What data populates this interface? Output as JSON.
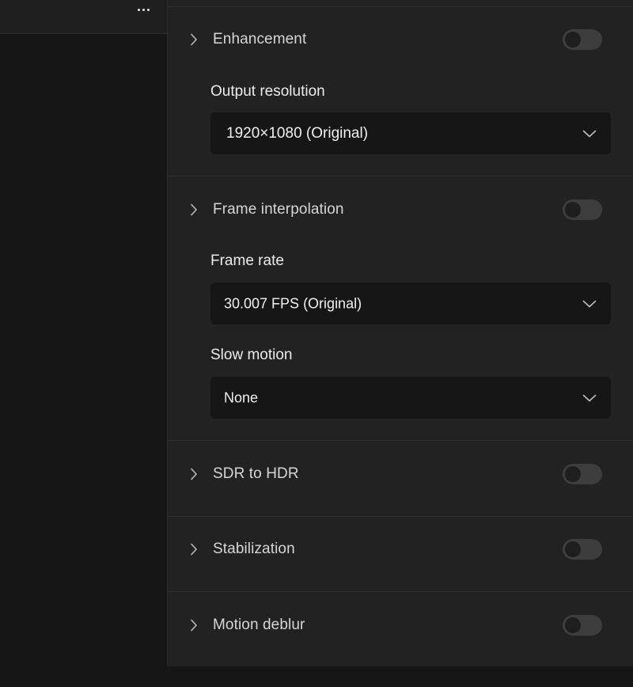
{
  "menu": {
    "icon": "more-horizontal-icon"
  },
  "sections": {
    "enhancement": {
      "title": "Enhancement",
      "enabled": false,
      "output_resolution": {
        "label": "Output resolution",
        "value": "1920×1080 (Original)"
      }
    },
    "frame_interpolation": {
      "title": "Frame interpolation",
      "enabled": false,
      "frame_rate": {
        "label": "Frame rate",
        "value": "30.007 FPS (Original)"
      },
      "slow_motion": {
        "label": "Slow motion",
        "value": "None"
      }
    },
    "sdr_to_hdr": {
      "title": "SDR to HDR",
      "enabled": false
    },
    "stabilization": {
      "title": "Stabilization",
      "enabled": false
    },
    "motion_deblur": {
      "title": "Motion deblur",
      "enabled": false
    }
  },
  "colors": {
    "panel_bg": "#222222",
    "dropdown_bg": "#161616",
    "toggle_off": "#3d3d3d"
  }
}
